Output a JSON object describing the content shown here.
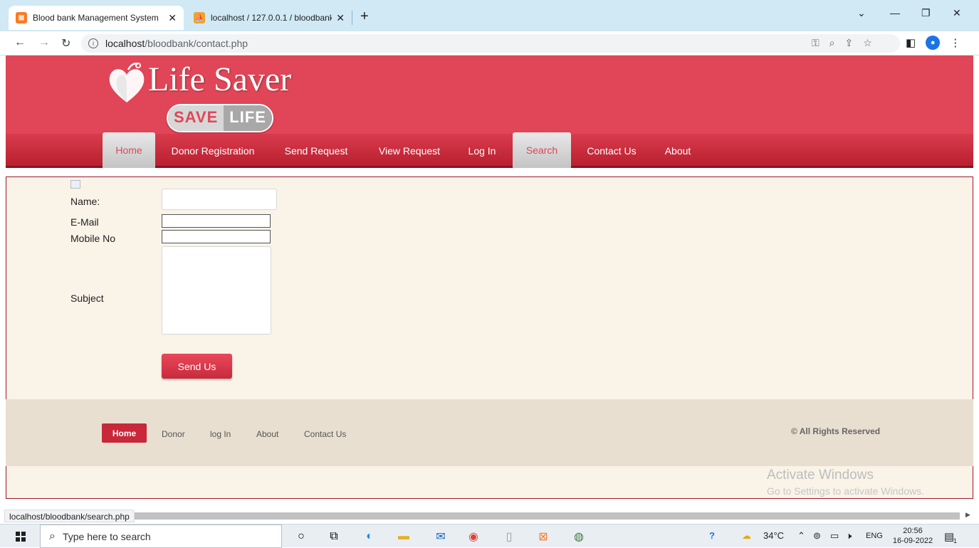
{
  "browser": {
    "tabs": [
      {
        "label": "Blood bank Management System",
        "favicon": "xampp-icon",
        "active": true
      },
      {
        "label": "localhost / 127.0.0.1 / bloodbank",
        "favicon": "phpmyadmin-icon",
        "active": false
      }
    ],
    "new_tab": "+",
    "close_glyph": "✕",
    "url_host": "localhost",
    "url_path": "/bloodbank/contact.php",
    "status_url": "localhost/bloodbank/search.php"
  },
  "site": {
    "logo_text": "Life Saver",
    "badge_left": "SAVE",
    "badge_right": "LIFE"
  },
  "nav": [
    {
      "label": "Home",
      "style": "light"
    },
    {
      "label": "Donor Registration",
      "style": "normal"
    },
    {
      "label": "Send Request",
      "style": "normal"
    },
    {
      "label": "View Request",
      "style": "normal"
    },
    {
      "label": "Log In",
      "style": "normal"
    },
    {
      "label": "Search",
      "style": "light"
    },
    {
      "label": "Contact Us",
      "style": "normal"
    },
    {
      "label": "About",
      "style": "normal"
    }
  ],
  "form": {
    "name_label": "Name:",
    "email_label": "E-Mail",
    "mobile_label": "Mobile No",
    "subject_label": "Subject",
    "name_value": "",
    "email_value": "",
    "mobile_value": "",
    "subject_value": "",
    "submit_label": "Send Us"
  },
  "footer": {
    "links": [
      "Home",
      "Donor",
      "log In",
      "About",
      "Contact Us"
    ],
    "copyright": "© All Rights Reserved"
  },
  "watermark": {
    "title": "Activate Windows",
    "subtitle": "Go to Settings to activate Windows."
  },
  "taskbar": {
    "search_placeholder": "Type here to search",
    "temperature": "34°C",
    "language": "ENG",
    "time": "20:56",
    "date": "16-09-2022",
    "notification_count": "1"
  },
  "colors": {
    "brand_red": "#e04657",
    "nav_red": "#c82a3c",
    "content_bg": "#f9f3e8",
    "footer_bg": "#e9dfd0"
  }
}
